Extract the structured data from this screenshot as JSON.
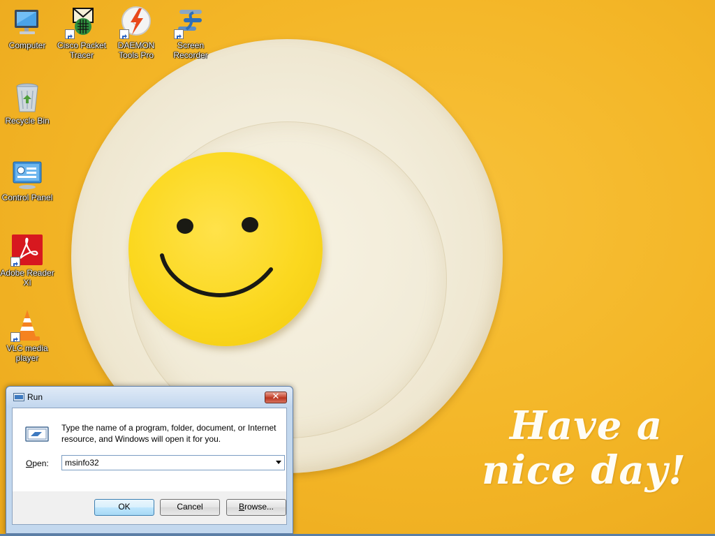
{
  "desktop": {
    "wallpaper_text": {
      "line1": "Have a",
      "line2": "nice day!"
    },
    "icons": [
      {
        "label": "Computer"
      },
      {
        "label": "Cisco Packet Tracer"
      },
      {
        "label": "DAEMON Tools Pro"
      },
      {
        "label": "Screen Recorder"
      },
      {
        "label": "Recycle Bin"
      },
      {
        "label": "Control Panel"
      },
      {
        "label": "Adobe Reader XI"
      },
      {
        "label": "VLC media player"
      }
    ]
  },
  "run_dialog": {
    "title": "Run",
    "close_label": "✕",
    "description": "Type the name of a program, folder, document, or Internet resource, and Windows will open it for you.",
    "open_label_underlined": "O",
    "open_label_rest": "pen:",
    "open_value": "msinfo32",
    "ok_label": "OK",
    "cancel_label": "Cancel",
    "browse_label_underlined": "B",
    "browse_label_rest": "rowse..."
  },
  "colors": {
    "wallpaper": "#f3b526",
    "window_frame": "#c3d8ee",
    "close_red": "#c6452f"
  }
}
